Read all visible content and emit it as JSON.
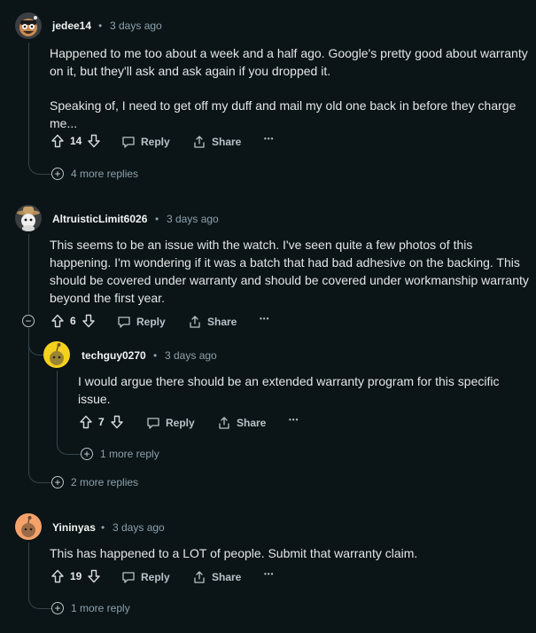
{
  "comments": [
    {
      "username": "jedee14",
      "sep": "•",
      "time": "3 days ago",
      "paragraphs": [
        "Happened to me too about a week and a half ago. Google's pretty good about warranty on it, but they'll ask and ask again if you dropped it.",
        "Speaking of, I need to get off my duff and mail my old one back in before they charge me..."
      ],
      "votes": "14",
      "reply_label": "Reply",
      "share_label": "Share",
      "more_icon": "•••",
      "more_replies": "4 more replies"
    },
    {
      "username": "AltruisticLimit6026",
      "sep": "•",
      "time": "3 days ago",
      "text": "This seems to be an issue with the watch. I've seen quite a few photos of this happening. I'm wondering if it was a batch that had bad adhesive on the backing. This should be covered under warranty and should be covered under workmanship warranty beyond the first year.",
      "votes": "6",
      "reply_label": "Reply",
      "share_label": "Share",
      "more_icon": "•••",
      "collapse_icon": "−",
      "more_replies": "2 more replies",
      "reply": {
        "username": "techguy0270",
        "sep": "•",
        "time": "3 days ago",
        "text": "I would argue there should be an extended warranty program for this specific issue.",
        "votes": "7",
        "reply_label": "Reply",
        "share_label": "Share",
        "more_icon": "•••",
        "more_replies": "1 more reply"
      }
    },
    {
      "username": "Yininyas",
      "sep": "•",
      "time": "3 days ago",
      "text": "This has happened to a LOT of people. Submit that warranty claim.",
      "votes": "19",
      "reply_label": "Reply",
      "share_label": "Share",
      "more_icon": "•••",
      "more_replies": "1 more reply"
    }
  ],
  "plus_icon": "+",
  "colors": {
    "background": "#0b1416",
    "thread_line": "#33464c",
    "muted_text": "#8ba2ad",
    "body_text": "#e3e6e8"
  }
}
